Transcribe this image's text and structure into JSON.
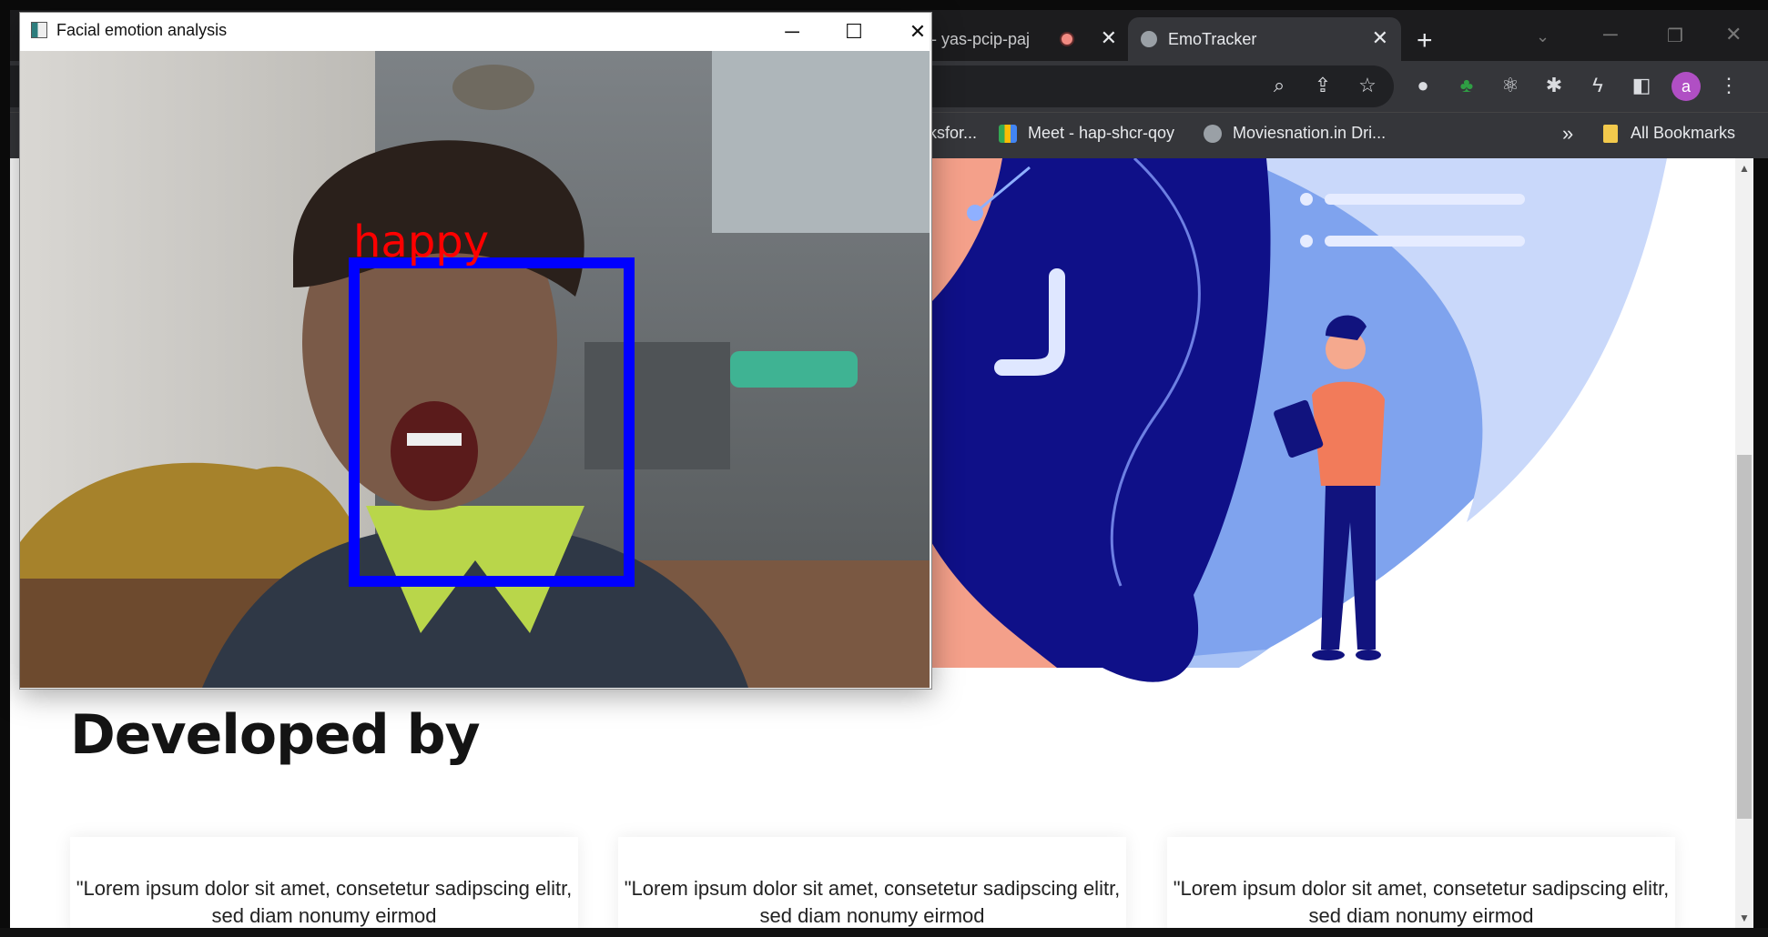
{
  "browser": {
    "tabs": [
      {
        "label": "- yas-pcip-paj",
        "active": false
      },
      {
        "label": "EmoTracker",
        "active": true
      }
    ],
    "new_tab_label": "+",
    "profile_initial": "a",
    "bookmarks": [
      {
        "label": "ksfor..."
      },
      {
        "label": "Meet - hap-shcr-qoy"
      },
      {
        "label": "Moviesnation.in Dri..."
      }
    ],
    "overflow_label": "»",
    "all_bookmarks_label": "All Bookmarks"
  },
  "page": {
    "section_heading": "Developed by",
    "cards": [
      {
        "text": "\"Lorem ipsum dolor sit amet, consetetur sadipscing elitr, sed diam nonumy eirmod"
      },
      {
        "text": "\"Lorem ipsum dolor sit amet, consetetur sadipscing elitr, sed diam nonumy eirmod"
      },
      {
        "text": "\"Lorem ipsum dolor sit amet, consetetur sadipscing elitr, sed diam nonumy eirmod"
      }
    ]
  },
  "webcam_window": {
    "title": "Facial emotion analysis",
    "emotion_label": "happy",
    "label_color": "#ff0000",
    "box_color": "#0000ff"
  },
  "colors": {
    "accent_blue": "#1a1a9c",
    "illustration_light": "#7fa8f0",
    "profile_bg": "#b04fc4"
  }
}
